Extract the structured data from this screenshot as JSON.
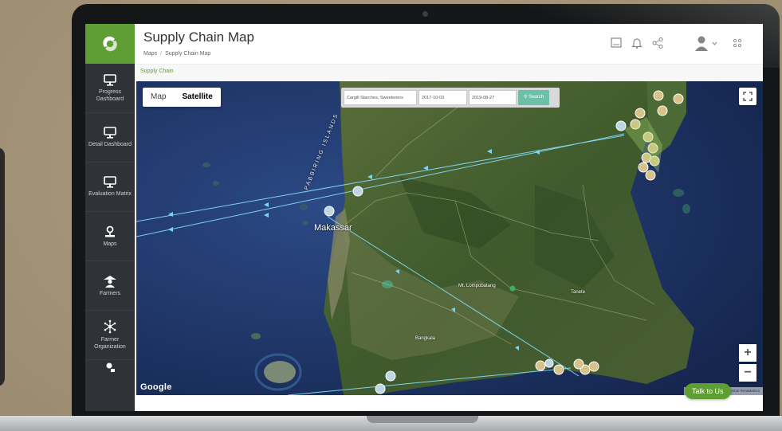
{
  "header": {
    "title": "Supply Chain Map",
    "breadcrumb": [
      "Maps",
      "Supply Chain Map"
    ]
  },
  "subheader": {
    "label": "Supply Chain"
  },
  "sidebar": {
    "items": [
      {
        "label": "Progress Dashboard",
        "icon": "monitor-icon"
      },
      {
        "label": "Detail Dashboard",
        "icon": "monitor-icon"
      },
      {
        "label": "Evaluation Matrix",
        "icon": "monitor-icon"
      },
      {
        "label": "Maps",
        "icon": "map-pin-icon"
      },
      {
        "label": "Farmers",
        "icon": "farmer-icon"
      },
      {
        "label": "Farmer Organization",
        "icon": "network-icon"
      }
    ]
  },
  "map": {
    "type_options": [
      "Map",
      "Satellite"
    ],
    "selected_type": "Satellite",
    "search": {
      "entity": "Cargill Starches, Sweeteners",
      "date_from": "2017-10-03",
      "date_to": "2019-08-27",
      "button": "Search"
    },
    "zoom_in": "+",
    "zoom_out": "−",
    "provider": "Google",
    "attribution": "Map data ©2019 Imagery ©2019 TerraMetrics",
    "labels": {
      "city": "Makassar",
      "island": "PABBIRING ISLANDS",
      "mountain": "Mt. Lompobatang",
      "town_right": "Tanete",
      "town_south": "Bangkala"
    }
  },
  "chat": {
    "label": "Talk to Us"
  },
  "colors": {
    "brand_green": "#5f9e32",
    "sidebar": "#2f3236",
    "route": "#7fd3ea",
    "search_button": "#6cc0a8"
  }
}
